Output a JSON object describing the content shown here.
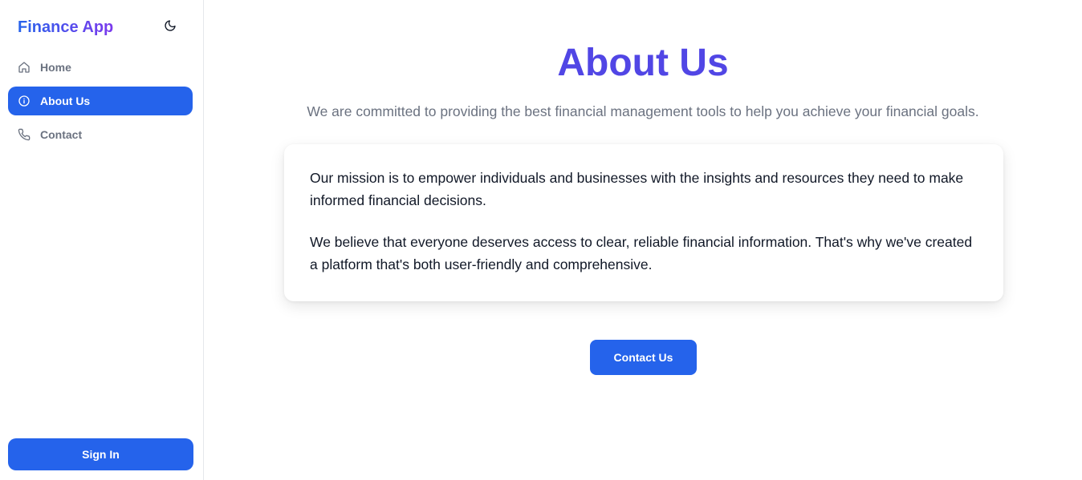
{
  "sidebar": {
    "brand": "Finance App",
    "theme_toggle_icon": "moon-icon",
    "nav": [
      {
        "label": "Home",
        "icon": "home-icon",
        "active": false
      },
      {
        "label": "About Us",
        "icon": "info-icon",
        "active": true
      },
      {
        "label": "Contact",
        "icon": "phone-icon",
        "active": false
      }
    ],
    "signin_label": "Sign In"
  },
  "main": {
    "title": "About Us",
    "subtitle": "We are committed to providing the best financial management tools to help you achieve your financial goals.",
    "paragraphs": [
      "Our mission is to empower individuals and businesses with the insights and resources they need to make informed financial decisions.",
      "We believe that everyone deserves access to clear, reliable financial information. That's why we've created a platform that's both user-friendly and comprehensive."
    ],
    "cta_label": "Contact Us"
  },
  "colors": {
    "accent": "#2563eb",
    "title": "#5146e5",
    "muted_text": "#6b7280",
    "body_text": "#111827"
  }
}
